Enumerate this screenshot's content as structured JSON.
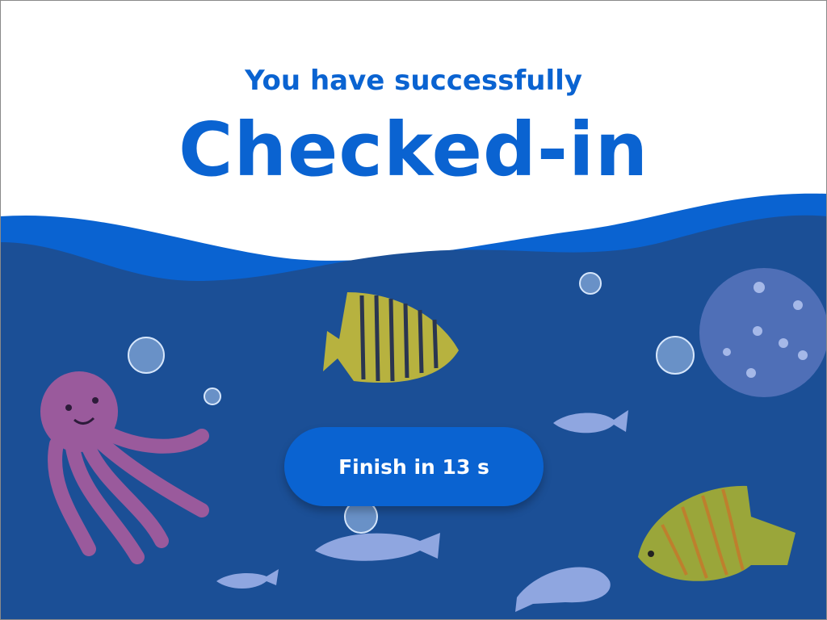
{
  "header": {
    "subtitle": "You have successfully",
    "title": "Checked-in"
  },
  "actions": {
    "finish_label": "Finish in 13 s"
  },
  "colors": {
    "brand_blue": "#0a63d1",
    "sea_dark": "#1b4f96",
    "wave_light": "#0a63d1",
    "background": "#ffffff"
  },
  "illustration": {
    "icons": [
      "octopus-icon",
      "striped-fish-icon",
      "pufferfish-icon",
      "small-fish-icon",
      "bubble-icon",
      "angelfish-icon"
    ]
  }
}
